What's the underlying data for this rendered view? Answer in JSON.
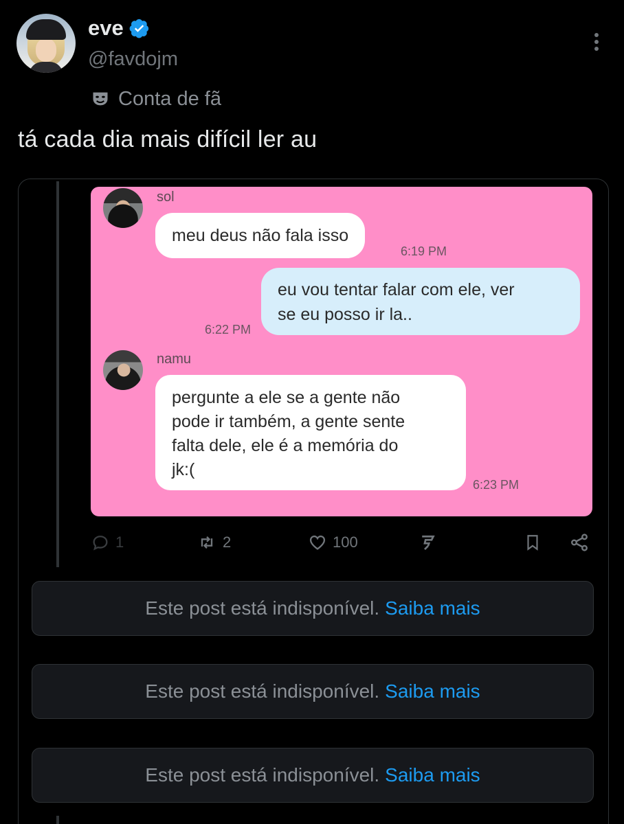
{
  "author": {
    "name": "eve",
    "handle": "@favdojm",
    "label": "Conta de fã",
    "verified_color": "#1d9bf0"
  },
  "tweet": {
    "text": "tá cada dia mais difícil ler au"
  },
  "quoted_image": {
    "background_color": "#ff8ec8",
    "messages": [
      {
        "sender": "sol",
        "text": "meu deus não fala isso",
        "time": "6:19 PM"
      },
      {
        "sender": "",
        "text_line1": "eu vou tentar falar com ele, ver",
        "text_line2": "se eu posso ir la..",
        "time": "6:22 PM"
      },
      {
        "sender": "namu",
        "text_line1": "pergunte a ele se a gente não",
        "text_line2": "pode ir também, a gente sente",
        "text_line3": "falta dele, ele é a memória do",
        "text_line4": "jk:(",
        "time": "6:23 PM"
      }
    ]
  },
  "actions": {
    "replies": "1",
    "reposts": "2",
    "likes": "100",
    "icons": [
      "reply-icon",
      "repost-icon",
      "like-icon",
      "grok-icon",
      "bookmark-icon",
      "share-icon"
    ]
  },
  "unavailable_posts": [
    {
      "text": "Este post está indisponível.",
      "link": "Saiba mais"
    },
    {
      "text": "Este post está indisponível.",
      "link": "Saiba mais"
    },
    {
      "text": "Este post está indisponível.",
      "link": "Saiba mais"
    }
  ]
}
